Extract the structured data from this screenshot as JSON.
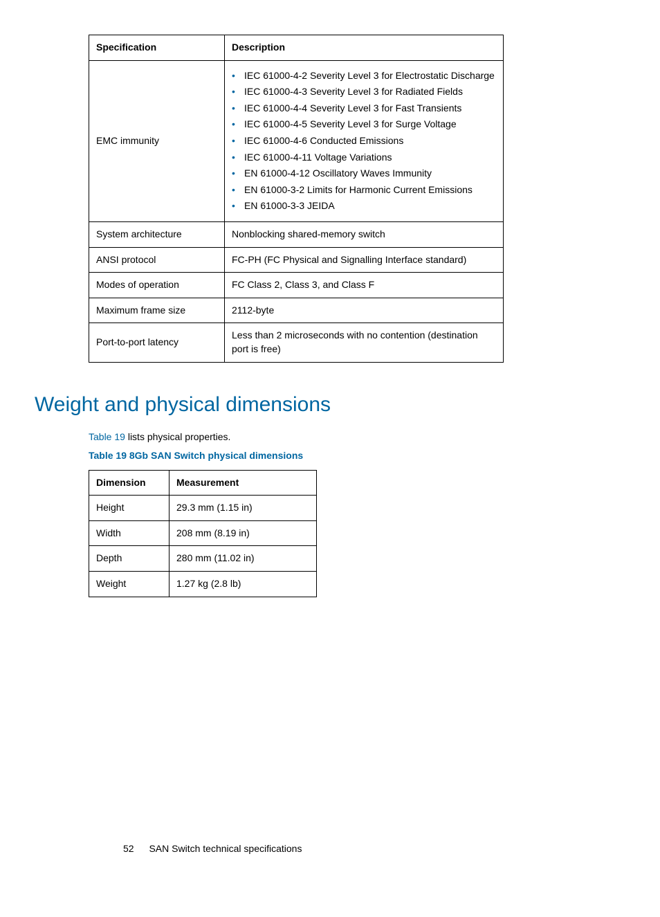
{
  "spec_table": {
    "headers": [
      "Specification",
      "Description"
    ],
    "rows": [
      {
        "spec": "EMC immunity",
        "list": [
          "IEC 61000-4-2 Severity Level 3 for Electrostatic Discharge",
          "IEC 61000-4-3 Severity Level 3 for Radiated Fields",
          "IEC 61000-4-4 Severity Level 3 for Fast Transients",
          "IEC 61000-4-5 Severity Level 3 for Surge Voltage",
          "IEC 61000-4-6 Conducted Emissions",
          "IEC 61000-4-11 Voltage Variations",
          "EN 61000-4-12 Oscillatory Waves Immunity",
          "EN 61000-3-2 Limits for Harmonic Current Emissions",
          "EN 61000-3-3 JEIDA"
        ]
      },
      {
        "spec": "System architecture",
        "desc": "Nonblocking shared-memory switch"
      },
      {
        "spec": "ANSI protocol",
        "desc": "FC-PH (FC Physical and Signalling Interface standard)"
      },
      {
        "spec": "Modes of operation",
        "desc": "FC Class 2, Class 3, and Class F"
      },
      {
        "spec": "Maximum frame size",
        "desc": "2112-byte"
      },
      {
        "spec": "Port-to-port latency",
        "desc": "Less than 2 microseconds with no contention (destination port is free)"
      }
    ]
  },
  "section_heading": "Weight and physical dimensions",
  "intro": {
    "link": "Table 19",
    "rest": " lists physical properties."
  },
  "dim_caption": "Table 19 8Gb SAN Switch physical dimensions",
  "dim_table": {
    "headers": [
      "Dimension",
      "Measurement"
    ],
    "rows": [
      {
        "dim": "Height",
        "meas": "29.3 mm (1.15 in)"
      },
      {
        "dim": "Width",
        "meas": "208 mm (8.19 in)"
      },
      {
        "dim": "Depth",
        "meas": "280 mm (11.02 in)"
      },
      {
        "dim": "Weight",
        "meas": "1.27 kg (2.8 lb)"
      }
    ]
  },
  "footer": {
    "page": "52",
    "title": "SAN Switch technical specifications"
  }
}
